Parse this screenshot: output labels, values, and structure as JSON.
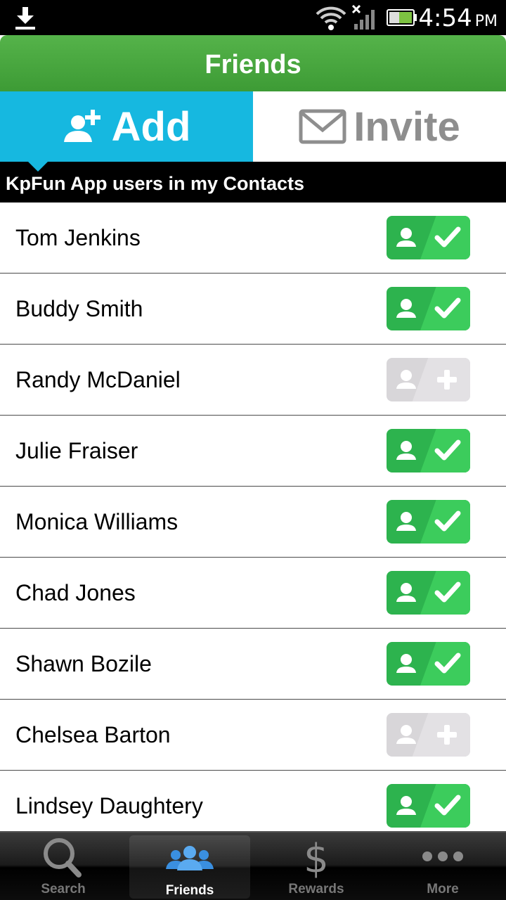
{
  "status_bar": {
    "time": "4:54",
    "ampm": "PM"
  },
  "title_bar": {
    "title": "Friends"
  },
  "tabs": {
    "add_label": "Add",
    "invite_label": "Invite",
    "active": "Add"
  },
  "section_header": "KpFun App users in my Contacts",
  "contacts": [
    {
      "name": "Tom Jenkins",
      "status": "added"
    },
    {
      "name": "Buddy Smith",
      "status": "added"
    },
    {
      "name": "Randy McDaniel",
      "status": "not_added"
    },
    {
      "name": "Julie Fraiser",
      "status": "added"
    },
    {
      "name": "Monica Williams",
      "status": "added"
    },
    {
      "name": "Chad Jones",
      "status": "added"
    },
    {
      "name": "Shawn Bozile",
      "status": "added"
    },
    {
      "name": "Chelsea Barton",
      "status": "not_added"
    },
    {
      "name": "Lindsey Daughtery",
      "status": "added"
    }
  ],
  "bottom_nav": {
    "items": [
      {
        "label": "Search",
        "icon": "search-icon"
      },
      {
        "label": "Friends",
        "icon": "friends-icon"
      },
      {
        "label": "Rewards",
        "icon": "dollar-icon"
      },
      {
        "label": "More",
        "icon": "more-icon"
      }
    ],
    "active": "Friends"
  },
  "colors": {
    "header_green": "#4caf45",
    "add_tab_blue": "#16b8e0",
    "added_green": "#2db34e",
    "not_added_gray": "#d8d6d9"
  }
}
